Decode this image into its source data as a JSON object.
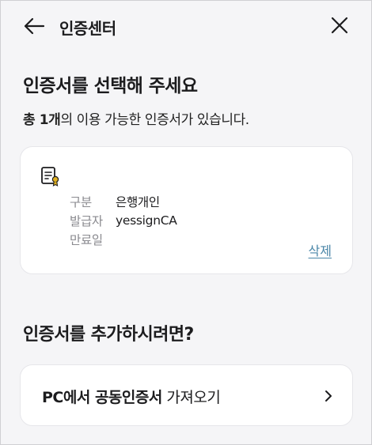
{
  "header": {
    "title": "인증센터",
    "back_icon": "arrow-left-icon",
    "close_icon": "close-icon"
  },
  "page": {
    "heading": "인증서를 선택해 주세요",
    "summary_prefix": "총 1개",
    "summary_rest": "의 이용 가능한 인증서가 있습니다."
  },
  "certificate": {
    "icon": "certificate-icon",
    "rows": [
      {
        "label": "구분",
        "value": "은행개인"
      },
      {
        "label": "발급자",
        "value": "yessignCA"
      },
      {
        "label": "만료일",
        "value": ""
      }
    ],
    "delete_label": "삭제"
  },
  "add_section": {
    "heading": "인증서를 추가하시려면?",
    "import_bold": "PC에서 공동인증서",
    "import_rest": " 가져오기",
    "chevron_icon": "chevron-right-icon"
  },
  "colors": {
    "background": "#f5f5f7",
    "card": "#ffffff",
    "link": "#4a86a8",
    "label": "#8a8a8f",
    "badge": "#e0b021"
  }
}
